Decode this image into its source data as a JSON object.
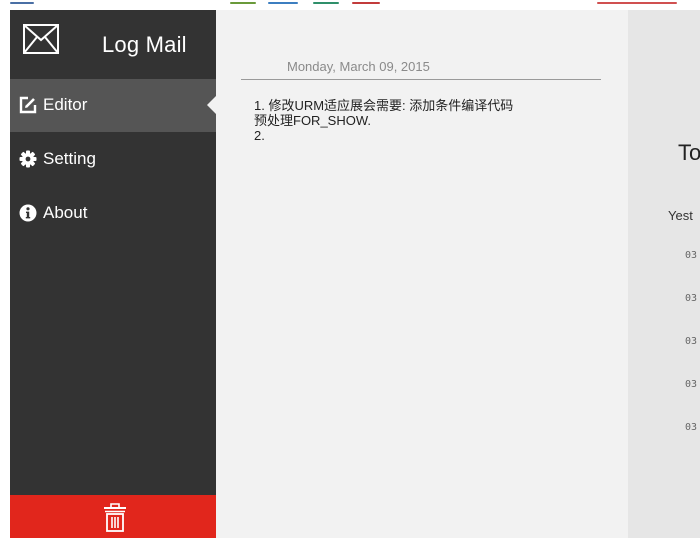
{
  "app": {
    "title": "Log Mail",
    "icon": "envelope-icon"
  },
  "sidebar": {
    "background": "#333333",
    "active_background": "#555555",
    "items": [
      {
        "label": "Editor",
        "icon": "edit-icon",
        "active": true
      },
      {
        "label": "Setting",
        "icon": "gear-icon",
        "active": false
      },
      {
        "label": "About",
        "icon": "info-icon",
        "active": false
      }
    ],
    "trash": {
      "icon": "trash-icon",
      "color": "#e1261c"
    }
  },
  "editor": {
    "date": "Monday, March 09, 2015",
    "lines": [
      "1. 修改URM适应展会需要: 添加条件编译代码",
      "预处理FOR_SHOW.",
      "2."
    ]
  },
  "preview": {
    "title": "To",
    "subtitle": "Yest",
    "entries": [
      "03",
      "03",
      "03",
      "03",
      "03"
    ]
  }
}
